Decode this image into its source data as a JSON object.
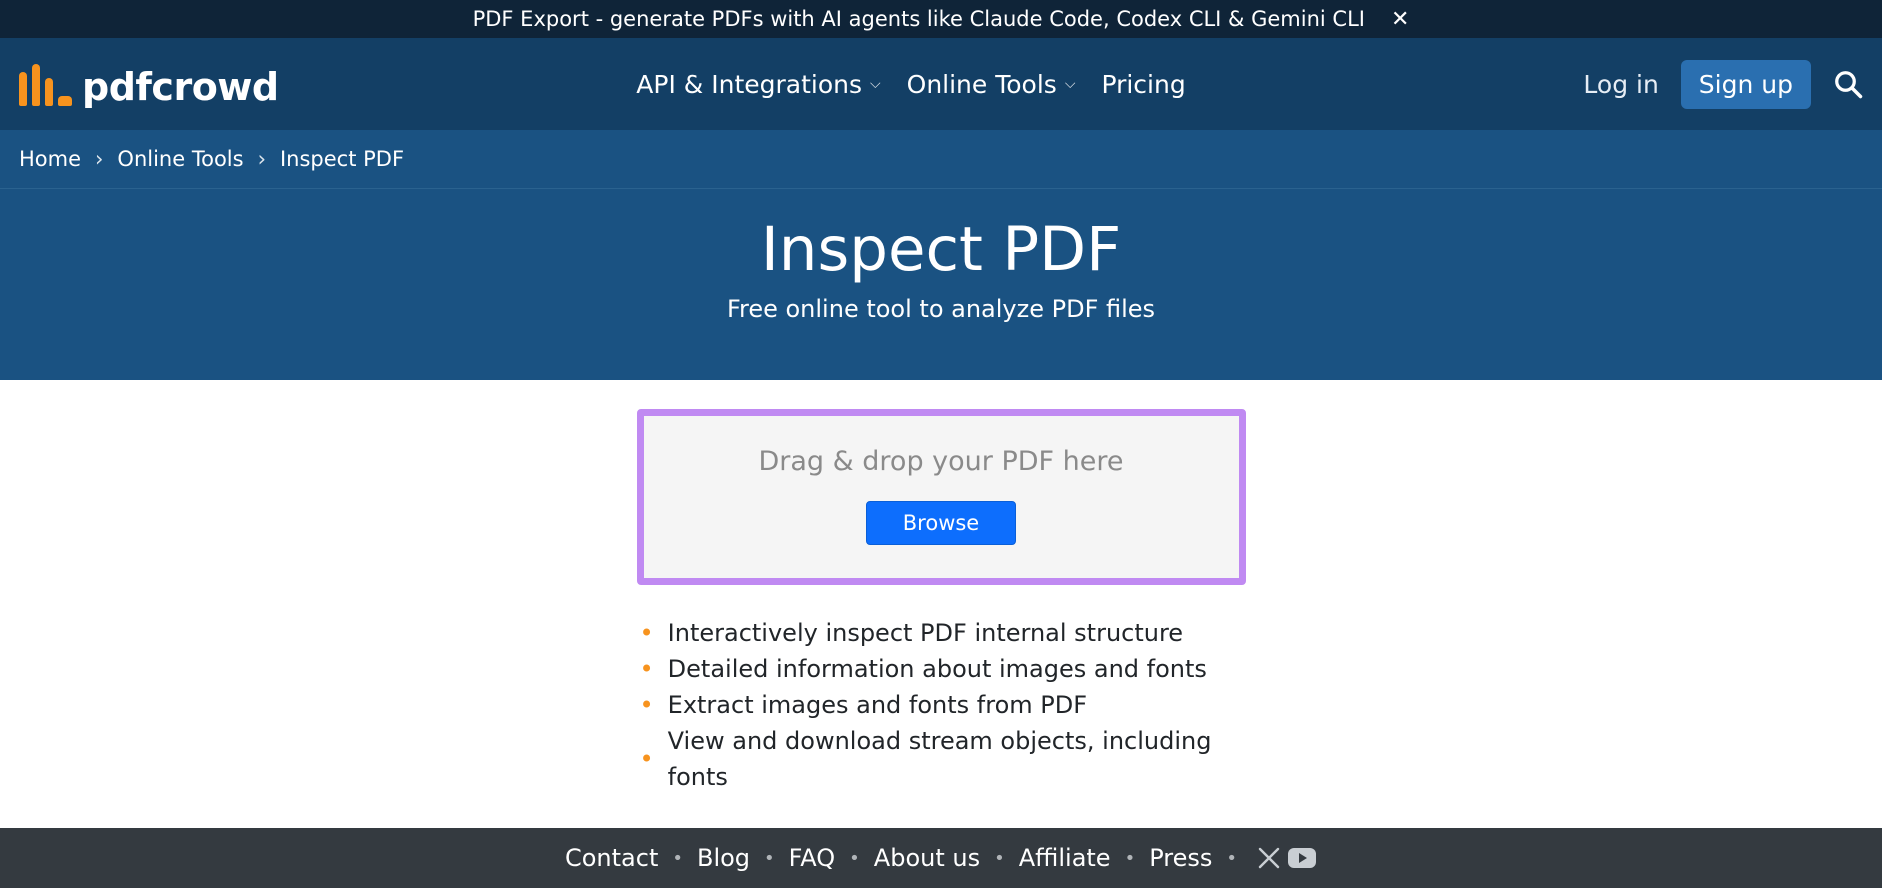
{
  "promo": {
    "text": "PDF Export - generate PDFs with AI agents like Claude Code, Codex CLI & Gemini CLI",
    "close": "✕"
  },
  "nav": {
    "logo_text": "pdfcrowd",
    "menu": [
      {
        "label": "API & Integrations",
        "has_dropdown": true
      },
      {
        "label": "Online Tools",
        "has_dropdown": true
      },
      {
        "label": "Pricing",
        "has_dropdown": false
      }
    ],
    "login": "Log in",
    "signup": "Sign up"
  },
  "breadcrumb": [
    "Home",
    "Online Tools",
    "Inspect PDF"
  ],
  "hero": {
    "title": "Inspect PDF",
    "subtitle": "Free online tool to analyze PDF files"
  },
  "dropzone": {
    "text": "Drag & drop your PDF here",
    "button": "Browse"
  },
  "features": [
    "Interactively inspect PDF internal structure",
    "Detailed information about images and fonts",
    "Extract images and fonts from PDF",
    "View and download stream objects, including fonts"
  ],
  "footer": {
    "links": [
      "Contact",
      "Blog",
      "FAQ",
      "About us",
      "Affiliate",
      "Press"
    ],
    "icons": [
      "x-icon",
      "youtube-icon"
    ]
  },
  "colors": {
    "promo_bg": "#0f2438",
    "nav_bg": "#133f65",
    "hero_bg": "#1a5282",
    "accent_orange": "#f7931e",
    "dropzone_border": "#c08af2",
    "browse_button": "#0d6efd",
    "footer_bg": "#343a40"
  }
}
